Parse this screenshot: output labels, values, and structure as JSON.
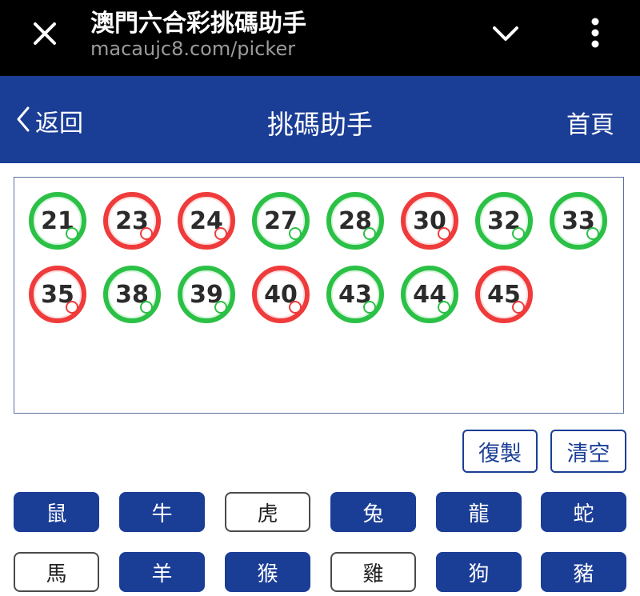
{
  "browser": {
    "title": "澳門六合彩挑碼助手",
    "url": "macaujc8.com/picker",
    "close_icon": "close-icon",
    "chevron_icon": "chevron-down-icon",
    "menu_icon": "more-vertical-icon"
  },
  "header": {
    "back_label": "返回",
    "title": "挑碼助手",
    "home_label": "首頁",
    "bg_color": "#1a3d96"
  },
  "balls": [
    {
      "number": "21",
      "color": "green"
    },
    {
      "number": "23",
      "color": "red"
    },
    {
      "number": "24",
      "color": "red"
    },
    {
      "number": "27",
      "color": "green"
    },
    {
      "number": "28",
      "color": "green"
    },
    {
      "number": "30",
      "color": "red"
    },
    {
      "number": "32",
      "color": "green"
    },
    {
      "number": "33",
      "color": "green"
    },
    {
      "number": "35",
      "color": "red"
    },
    {
      "number": "38",
      "color": "green"
    },
    {
      "number": "39",
      "color": "green"
    },
    {
      "number": "40",
      "color": "red"
    },
    {
      "number": "43",
      "color": "green"
    },
    {
      "number": "44",
      "color": "green"
    },
    {
      "number": "45",
      "color": "red"
    }
  ],
  "actions": {
    "copy_label": "復製",
    "clear_label": "清空"
  },
  "zodiacs": [
    {
      "label": "鼠",
      "selected": true
    },
    {
      "label": "牛",
      "selected": true
    },
    {
      "label": "虎",
      "selected": false
    },
    {
      "label": "兔",
      "selected": true
    },
    {
      "label": "龍",
      "selected": true
    },
    {
      "label": "蛇",
      "selected": true
    },
    {
      "label": "馬",
      "selected": false
    },
    {
      "label": "羊",
      "selected": true
    },
    {
      "label": "猴",
      "selected": true
    },
    {
      "label": "雞",
      "selected": false
    },
    {
      "label": "狗",
      "selected": true
    },
    {
      "label": "豬",
      "selected": true
    }
  ],
  "colors": {
    "green": "#2bc046",
    "red": "#ef3b3b",
    "accent": "#1a3d96"
  }
}
